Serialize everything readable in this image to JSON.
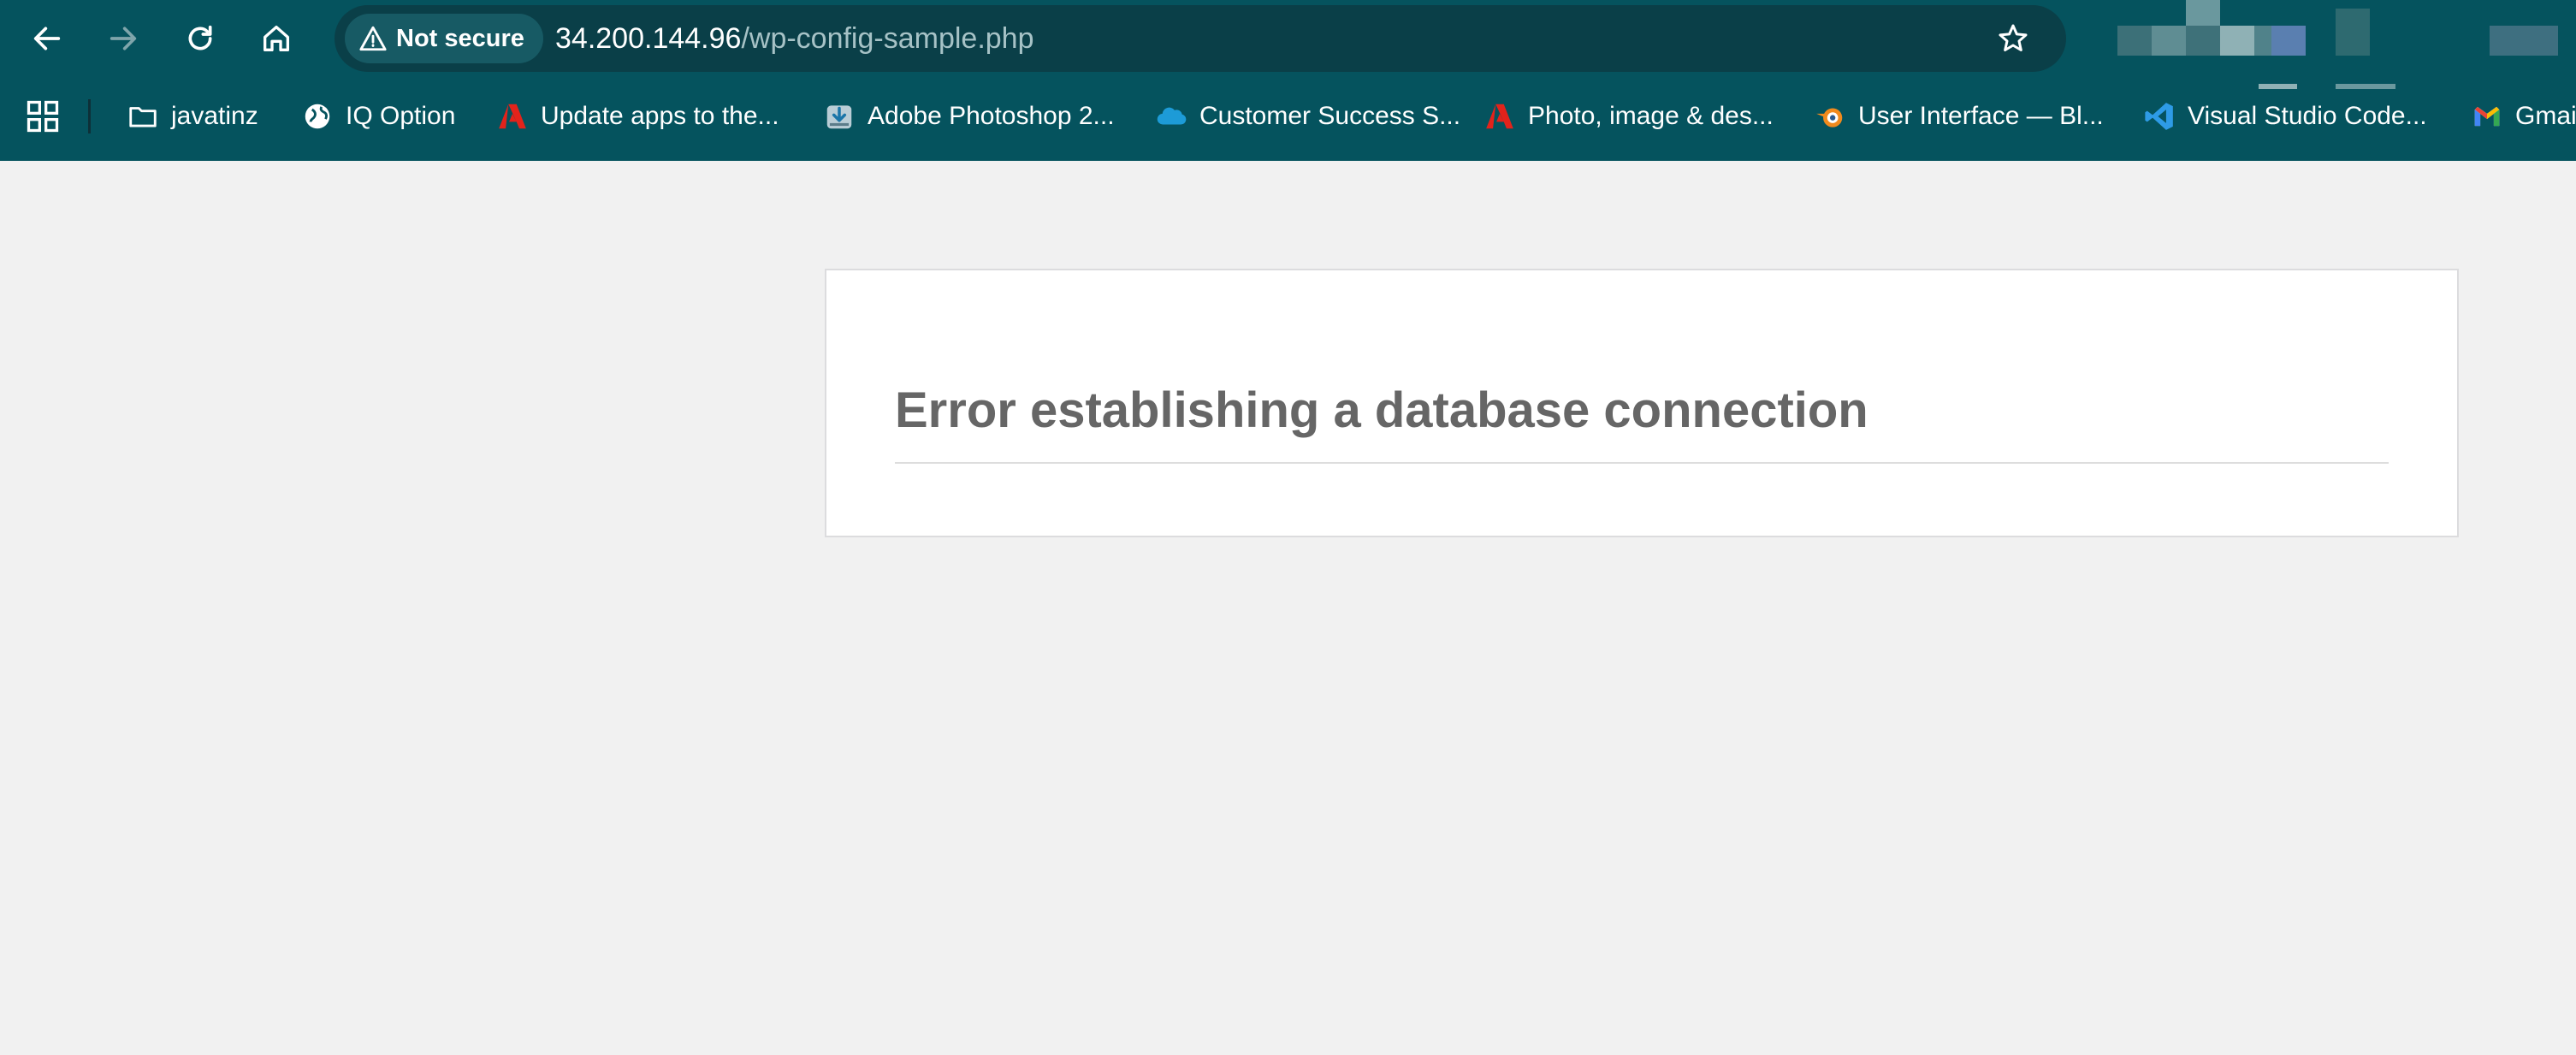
{
  "browser": {
    "nav": {
      "back_icon": "arrow-left-icon",
      "forward_icon": "arrow-right-icon",
      "reload_icon": "reload-icon",
      "home_icon": "home-icon"
    },
    "omnibox": {
      "security_label": "Not secure",
      "url_host": "34.200.144.96",
      "url_path": "/wp-config-sample.php"
    },
    "bookmarks": [
      {
        "label": "javatinz",
        "icon": "folder-icon"
      },
      {
        "label": "IQ Option",
        "icon": "globe-icon"
      },
      {
        "label": "Update apps to the...",
        "icon": "adobe-icon"
      },
      {
        "label": "Adobe Photoshop 2...",
        "icon": "download-icon"
      },
      {
        "label": "Customer Success S...",
        "icon": "salesforce-icon"
      },
      {
        "label": "Photo, image & des...",
        "icon": "adobe-icon"
      },
      {
        "label": "User Interface — Bl...",
        "icon": "blender-icon"
      },
      {
        "label": "Visual Studio Code...",
        "icon": "vscode-icon"
      },
      {
        "label": "Gmai",
        "icon": "gmail-icon"
      }
    ]
  },
  "page": {
    "error_title": "Error establishing a database connection"
  },
  "colors": {
    "chrome": "#05535e",
    "page_bg": "#f1f1f1",
    "error_text": "#666666"
  }
}
